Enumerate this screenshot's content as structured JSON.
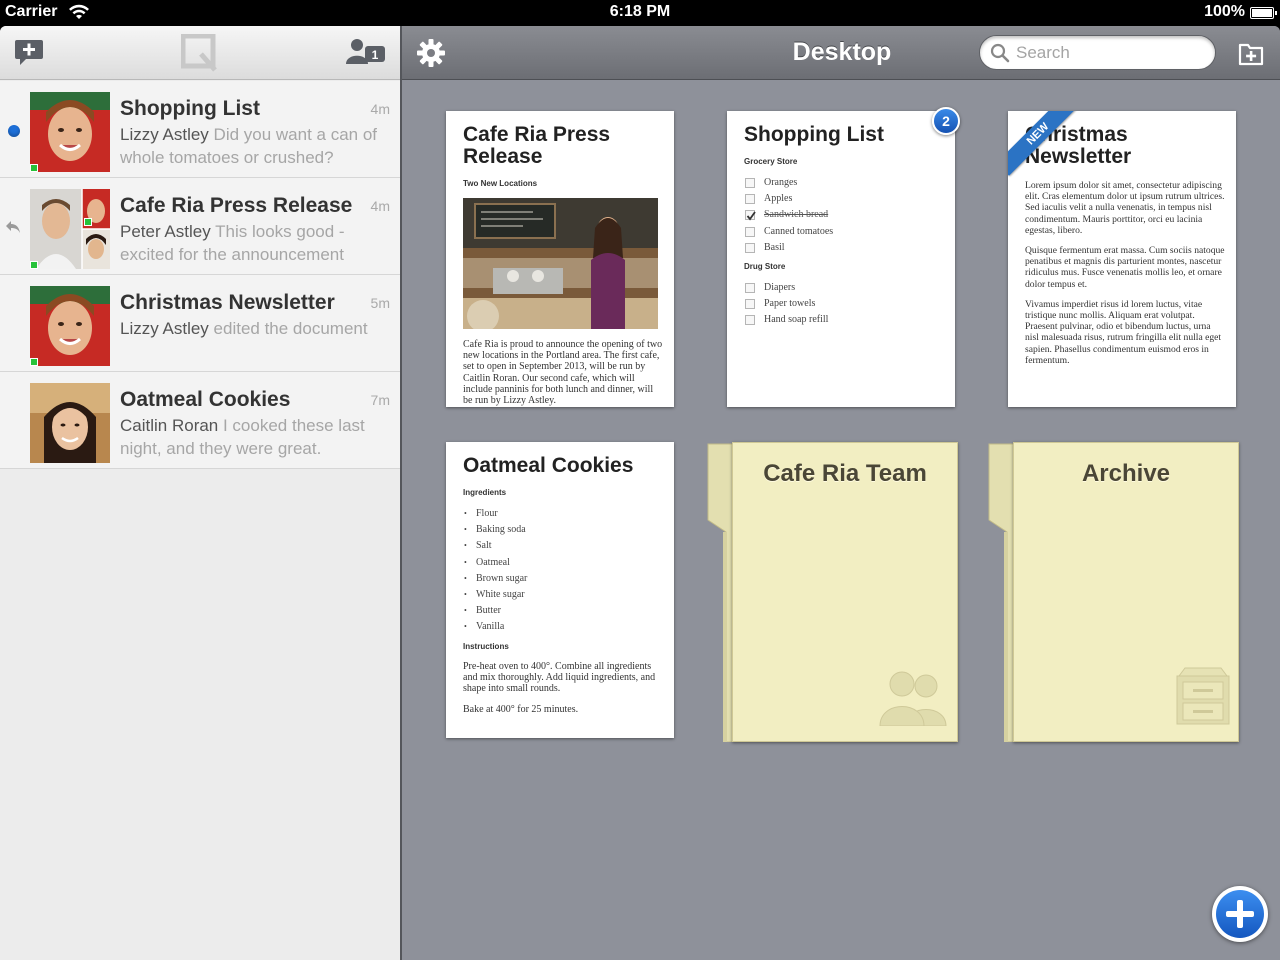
{
  "status_bar": {
    "carrier": "Carrier",
    "time": "6:18 PM",
    "battery": "100%"
  },
  "left_toolbar": {
    "new_message_icon": "compose-bubble-icon",
    "logo_icon": "quip-logo-icon",
    "contacts_icon": "people-icon",
    "contacts_count": "1"
  },
  "conversations": [
    {
      "title": "Shopping List",
      "time": "4m",
      "author": "Lizzy Astley",
      "message": " Did you want a can of whole tomatoes or crushed?",
      "indicator": "unread-dot"
    },
    {
      "title": "Cafe Ria Press Release",
      "time": "4m",
      "author": "Peter Astley",
      "message": " This looks good - excited for the announcement",
      "indicator": "reply-icon"
    },
    {
      "title": "Christmas Newsletter",
      "time": "5m",
      "author": "Lizzy Astley",
      "message": " edited the document",
      "indicator": ""
    },
    {
      "title": "Oatmeal Cookies",
      "time": "7m",
      "author": "Caitlin Roran",
      "message": " I cooked these last night, and they were great.",
      "indicator": ""
    }
  ],
  "right_toolbar": {
    "title": "Desktop",
    "search_placeholder": "Search",
    "settings_icon": "gear-icon",
    "new_folder_icon": "new-folder-icon"
  },
  "documents": {
    "press_release": {
      "title": "Cafe Ria Press Release",
      "subtitle": "Two New Locations",
      "body": "Cafe Ria is proud to announce the opening of two new locations in the Portland area. The first cafe, set to open in September 2013, will be run by Caitlin Roran. Our second cafe, which will include panninis for both lunch and dinner, will be run by Lizzy Astley."
    },
    "shopping_list": {
      "title": "Shopping List",
      "badge": "2",
      "section1": "Grocery Store",
      "items1": [
        {
          "label": "Oranges",
          "checked": false
        },
        {
          "label": "Apples",
          "checked": false
        },
        {
          "label": "Sandwich bread",
          "checked": true
        },
        {
          "label": "Canned tomatoes",
          "checked": false
        },
        {
          "label": "Basil",
          "checked": false
        }
      ],
      "section2": "Drug Store",
      "items2": [
        {
          "label": "Diapers",
          "checked": false
        },
        {
          "label": "Paper towels",
          "checked": false
        },
        {
          "label": "Hand soap refill",
          "checked": false
        }
      ]
    },
    "newsletter": {
      "ribbon": "NEW",
      "title": "Christmas Newsletter",
      "para1": "Lorem ipsum dolor sit amet, consectetur adipiscing elit. Cras elementum dolor ut ipsum rutrum ultrices. Sed iaculis velit a nulla venenatis, in tempus nisl condimentum. Mauris porttitor, orci eu lacinia egestas, libero.",
      "para2": "Quisque fermentum erat massa. Cum sociis natoque penatibus et magnis dis parturient montes, nascetur ridiculus mus. Fusce venenatis mollis leo, et ornare dolor tempus et.",
      "para3": "Vivamus imperdiet risus id lorem luctus, vitae tristique nunc mollis. Aliquam erat volutpat. Praesent pulvinar, odio et bibendum luctus, urna nisl malesuada risus, rutrum fringilla elit nulla eget sapien. Phasellus condimentum euismod eros in fermentum."
    },
    "cookies": {
      "title": "Oatmeal Cookies",
      "section1": "Ingredients",
      "ingredients": [
        "Flour",
        "Baking soda",
        "Salt",
        "Oatmeal",
        "Brown sugar",
        "White sugar",
        "Butter",
        "Vanilla"
      ],
      "section2": "Instructions",
      "para1": "Pre-heat oven to 400°. Combine all ingredients and mix thoroughly. Add liquid ingredients, and shape into small rounds.",
      "para2": "Bake at 400° for 25 minutes."
    }
  },
  "folders": [
    {
      "title": "Cafe Ria Team",
      "icon": "team-people-icon"
    },
    {
      "title": "Archive",
      "icon": "filing-cabinet-icon"
    }
  ],
  "fab": {
    "icon": "plus-icon"
  },
  "colors": {
    "accent_blue": "#1d6fd8",
    "online_green": "#27c23a",
    "folder_yellow": "#f2eec2",
    "desk_gray": "#8e919a"
  }
}
